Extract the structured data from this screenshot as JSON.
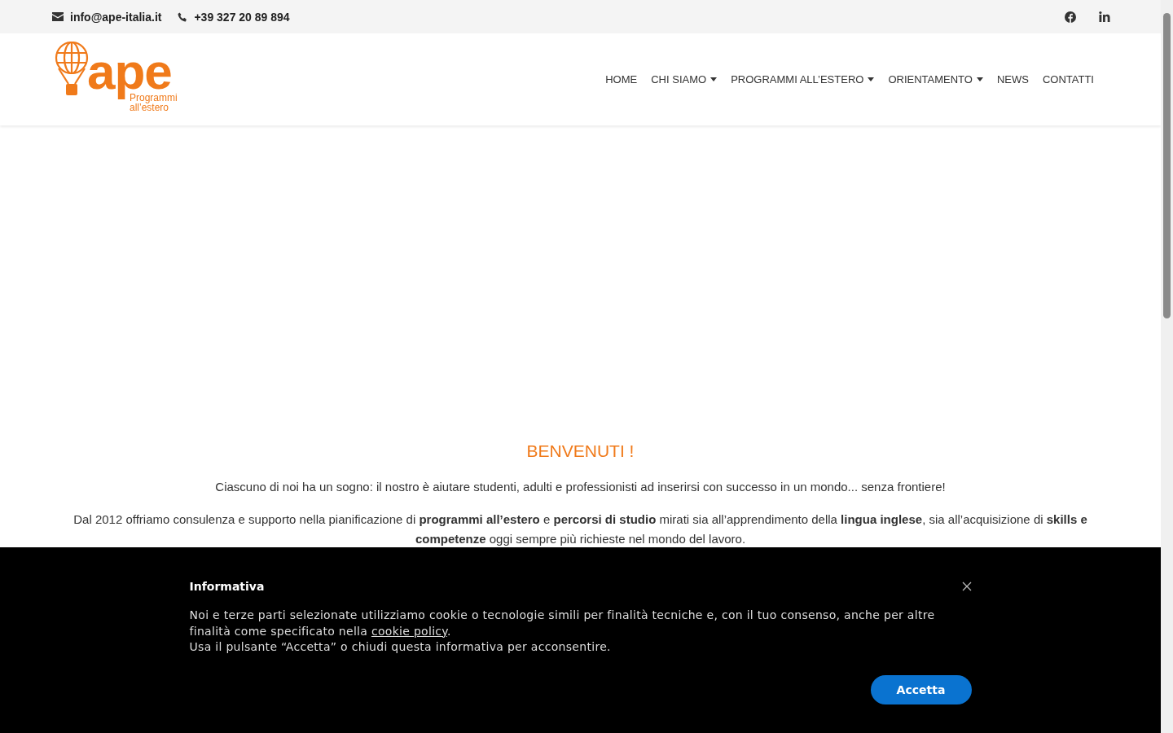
{
  "topbar": {
    "email": "info@ape-italia.it",
    "phone": "+39 327 20 89 894"
  },
  "logo": {
    "wordmark": "ape",
    "tagline_1": "Programmi",
    "tagline_2": "all’estero"
  },
  "nav": [
    {
      "label": "HOME",
      "dropdown": false
    },
    {
      "label": "CHI SIAMO",
      "dropdown": true
    },
    {
      "label": "PROGRAMMI ALL’ESTERO",
      "dropdown": true
    },
    {
      "label": "ORIENTAMENTO",
      "dropdown": true
    },
    {
      "label": "NEWS",
      "dropdown": false
    },
    {
      "label": "CONTATTI",
      "dropdown": false
    }
  ],
  "welcome": {
    "heading": "BENVENUTI !",
    "paragraphs": [
      "Ciascuno di noi ha un sogno: il nostro è aiutare studenti, adulti e professionisti ad inserirsi con successo in un mondo... senza frontiere!",
      "Dal 2012 offriamo consulenza e supporto nella pianificazione di **programmi all’estero** e **percorsi di studio** mirati sia all’apprendimento della **lingua inglese**, sia all’acquisizione di **skills e competenze** oggi sempre più richieste nel mondo del lavoro."
    ]
  },
  "cookie_banner": {
    "title": "Informativa",
    "text_before_link": "Noi e terze parti selezionate utilizziamo cookie o tecnologie simili per finalità tecniche e, con il tuo consenso, anche per altre finalità come specificato nella ",
    "link": "cookie policy",
    "text_after_link": ".",
    "text_2": "Usa il pulsante “Accetta” o chiudi questa informativa per acconsentire.",
    "button": "Accetta"
  }
}
